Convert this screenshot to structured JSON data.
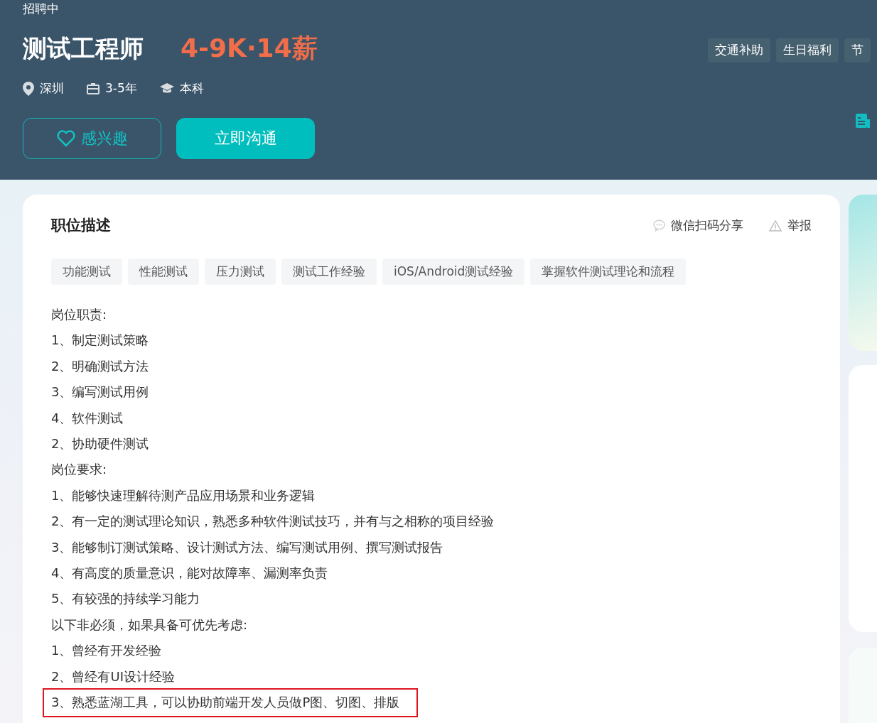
{
  "header": {
    "status": "招聘中",
    "title": "测试工程师",
    "salary": "4-9K·14薪",
    "meta": [
      {
        "kind": "location",
        "text": "深圳"
      },
      {
        "kind": "experience",
        "text": "3-5年"
      },
      {
        "kind": "education",
        "text": "本科"
      }
    ],
    "interest_button": "感兴趣",
    "chat_button": "立即沟通",
    "benefits": [
      "交通补助",
      "生日福利",
      "节"
    ]
  },
  "card": {
    "title": "职位描述",
    "share": "微信扫码分享",
    "report": "举报",
    "tags": [
      "功能测试",
      "性能测试",
      "压力测试",
      "测试工作经验",
      "iOS/Android测试经验",
      "掌握软件测试理论和流程"
    ],
    "lines": [
      {
        "text": "岗位职责:",
        "highlighted": false
      },
      {
        "text": "1、制定测试策略",
        "highlighted": false
      },
      {
        "text": "2、明确测试方法",
        "highlighted": false
      },
      {
        "text": "3、编写测试用例",
        "highlighted": false
      },
      {
        "text": "4、软件测试",
        "highlighted": false
      },
      {
        "text": "2、协助硬件测试",
        "highlighted": false
      },
      {
        "text": "岗位要求:",
        "highlighted": false
      },
      {
        "text": "1、能够快速理解待测产品应用场景和业务逻辑",
        "highlighted": false
      },
      {
        "text": "2、有一定的测试理论知识，熟悉多种软件测试技巧，并有与之相称的项目经验",
        "highlighted": false
      },
      {
        "text": "3、能够制订测试策略、设计测试方法、编写测试用例、撰写测试报告",
        "highlighted": false
      },
      {
        "text": "4、有高度的质量意识，能对故障率、漏测率负责",
        "highlighted": false
      },
      {
        "text": "5、有较强的持续学习能力",
        "highlighted": false
      },
      {
        "text": "以下非必须，如果具备可优先考虑:",
        "highlighted": false
      },
      {
        "text": "1、曾经有开发经验",
        "highlighted": false
      },
      {
        "text": "2、曾经有UI设计经验",
        "highlighted": false
      },
      {
        "text": "3、熟悉蓝湖工具，可以协助前端开发人员做P图、切图、排版",
        "highlighted": true
      }
    ]
  }
}
